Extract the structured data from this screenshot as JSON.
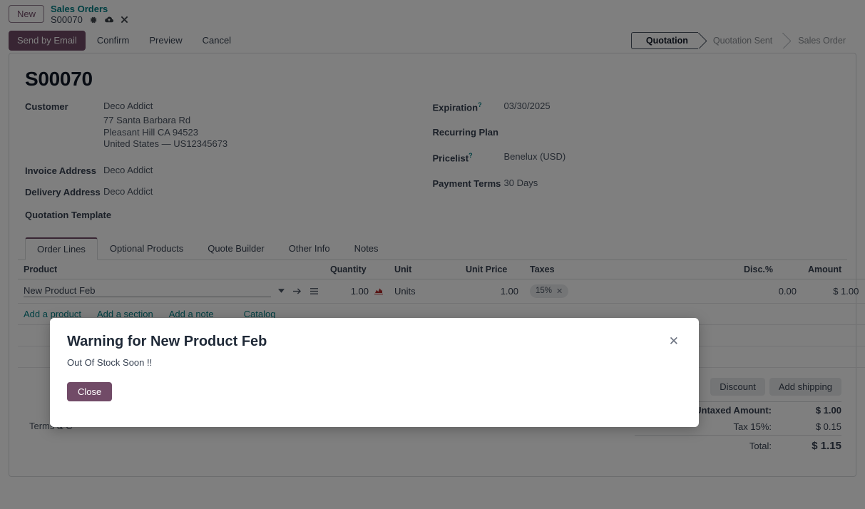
{
  "breadcrumb": {
    "new_label": "New",
    "parent": "Sales Orders",
    "current": "S00070",
    "gear_icon": "gear-icon",
    "save_icon": "cloud-save-icon",
    "discard_icon": "discard-x-icon"
  },
  "actions": {
    "send_by_email": "Send by Email",
    "confirm": "Confirm",
    "preview": "Preview",
    "cancel": "Cancel"
  },
  "statusbar": {
    "stages": [
      {
        "label": "Quotation",
        "active": true
      },
      {
        "label": "Quotation Sent",
        "active": false
      },
      {
        "label": "Sales Order",
        "active": false
      }
    ]
  },
  "record": {
    "title": "S00070"
  },
  "left_fields": {
    "customer_label": "Customer",
    "customer_value": "Deco Addict",
    "address_lines": [
      "77 Santa Barbara Rd",
      "Pleasant Hill CA 94523",
      "United States — US12345673"
    ],
    "invoice_address_label": "Invoice Address",
    "invoice_address_value": "Deco Addict",
    "delivery_address_label": "Delivery Address",
    "delivery_address_value": "Deco Addict",
    "quotation_template_label": "Quotation Template",
    "quotation_template_value": ""
  },
  "right_fields": {
    "expiration_label": "Expiration",
    "expiration_value": "03/30/2025",
    "recurring_plan_label": "Recurring Plan",
    "recurring_plan_value": "",
    "pricelist_label": "Pricelist",
    "pricelist_value": "Benelux (USD)",
    "payment_terms_label": "Payment Terms",
    "payment_terms_value": "30 Days",
    "tooltip_marker": "?"
  },
  "tabs": [
    {
      "label": "Order Lines",
      "active": true
    },
    {
      "label": "Optional Products",
      "active": false
    },
    {
      "label": "Quote Builder",
      "active": false
    },
    {
      "label": "Other Info",
      "active": false
    },
    {
      "label": "Notes",
      "active": false
    }
  ],
  "order_lines": {
    "columns": {
      "product": "Product",
      "quantity": "Quantity",
      "unit": "Unit",
      "unit_price": "Unit Price",
      "taxes": "Taxes",
      "discount": "Disc.%",
      "amount": "Amount"
    },
    "optional_columns_icon": "column-options-icon",
    "rows": [
      {
        "product": "New Product Feb",
        "quantity": "1.00",
        "forecast_icon": "forecast-report-icon",
        "unit": "Units",
        "unit_price": "1.00",
        "tax": "15%",
        "tax_remove_icon": "remove-tax-icon",
        "discount": "0.00",
        "amount": "$ 1.00",
        "delete_icon": "trash-icon",
        "dropdown_icon": "chevron-down-icon",
        "internal_link_icon": "internal-link-arrow-icon",
        "drag_icon": "drag-handle-icon"
      }
    ],
    "add_links": {
      "add_product": "Add a product",
      "add_section": "Add a section",
      "add_note": "Add a note",
      "catalog": "Catalog"
    }
  },
  "terms": {
    "label": "Terms & C"
  },
  "totals": {
    "discount_button": "Discount",
    "add_shipping_button": "Add shipping",
    "rows": [
      {
        "label": "Untaxed Amount:",
        "value": "$ 1.00",
        "strong": true
      },
      {
        "label": "Tax 15%:",
        "value": "$ 0.15",
        "strong": false
      }
    ],
    "total_label": "Total:",
    "total_value": "$ 1.15"
  },
  "modal": {
    "title": "Warning for New Product Feb",
    "body": "Out Of Stock Soon !!",
    "close_button": "Close",
    "close_icon": "close-x-icon"
  },
  "colors": {
    "brand_purple": "#714b67",
    "link_teal": "#017e84",
    "forecast_red": "#b02b2b"
  }
}
